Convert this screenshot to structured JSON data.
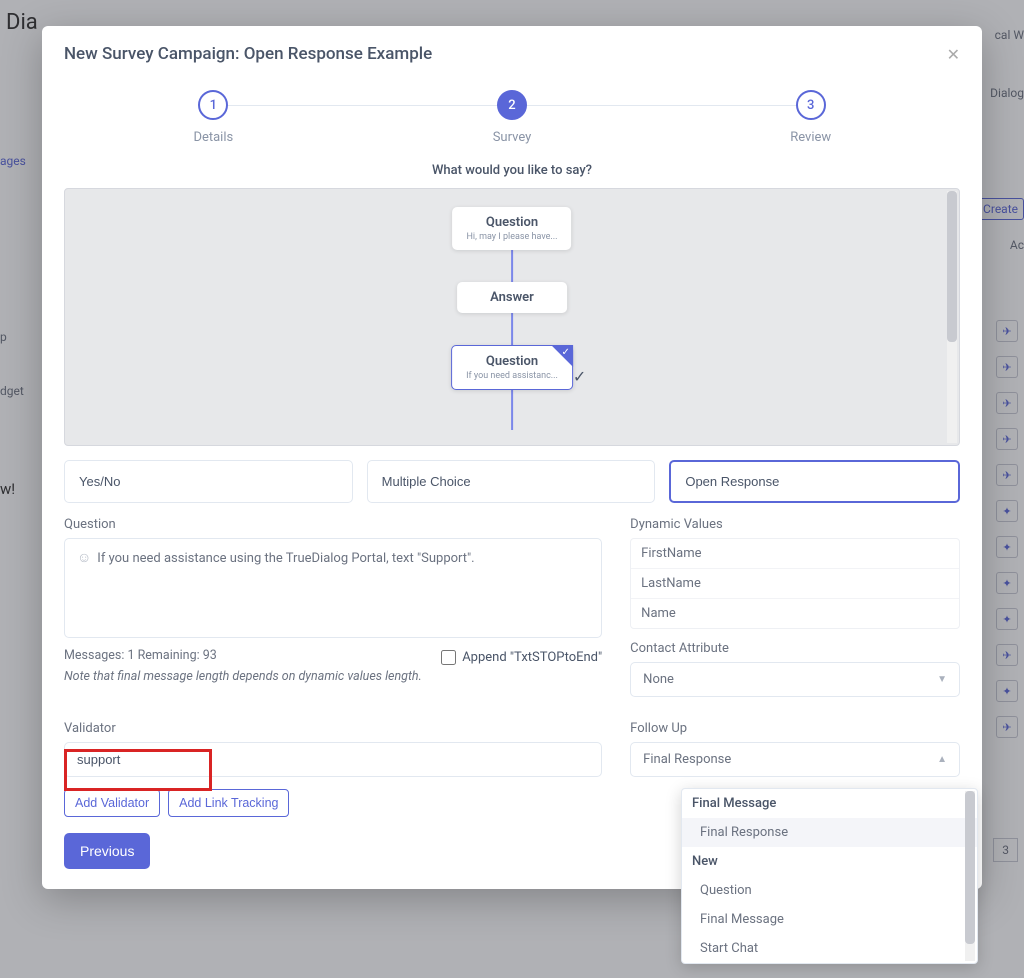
{
  "bg": {
    "title": "Dia",
    "side_link": "ages",
    "side2": "p",
    "side3": "dget",
    "side4": "w!",
    "right1": "cal W",
    "right2": "Dialog",
    "right3": "Create",
    "right4": "Ac",
    "right_num": "3"
  },
  "modal": {
    "title": "New Survey Campaign: Open Response Example",
    "steps": [
      {
        "num": "1",
        "label": "Details"
      },
      {
        "num": "2",
        "label": "Survey"
      },
      {
        "num": "3",
        "label": "Review"
      }
    ],
    "prompt": "What would you like to say?",
    "flow": {
      "q1_title": "Question",
      "q1_sub": "Hi, may I please have...",
      "a1_title": "Answer",
      "q2_title": "Question",
      "q2_sub": "If you need assistanc..."
    },
    "types": {
      "yesno": "Yes/No",
      "multiple": "Multiple Choice",
      "open": "Open Response"
    },
    "question_label": "Question",
    "question_value": "If you need assistance using the TrueDialog Portal, text \"Support\".",
    "msg_counter": "Messages: 1 Remaining: 93",
    "note": "Note that final message length depends on dynamic values length.",
    "append_label": "Append \"TxtSTOPtoEnd\"",
    "dv_label": "Dynamic Values",
    "dv_items": [
      "FirstName",
      "LastName",
      "Name"
    ],
    "ca_label": "Contact Attribute",
    "ca_value": "None",
    "validator_label": "Validator",
    "validator_value": "support",
    "add_validator": "Add Validator",
    "add_link": "Add Link Tracking",
    "previous": "Previous",
    "followup_label": "Follow Up",
    "followup_value": "Final Response"
  },
  "dropdown": {
    "group1": "Final Message",
    "items1": [
      "Final Response"
    ],
    "group2": "New",
    "items2": [
      "Question",
      "Final Message",
      "Start Chat"
    ]
  }
}
